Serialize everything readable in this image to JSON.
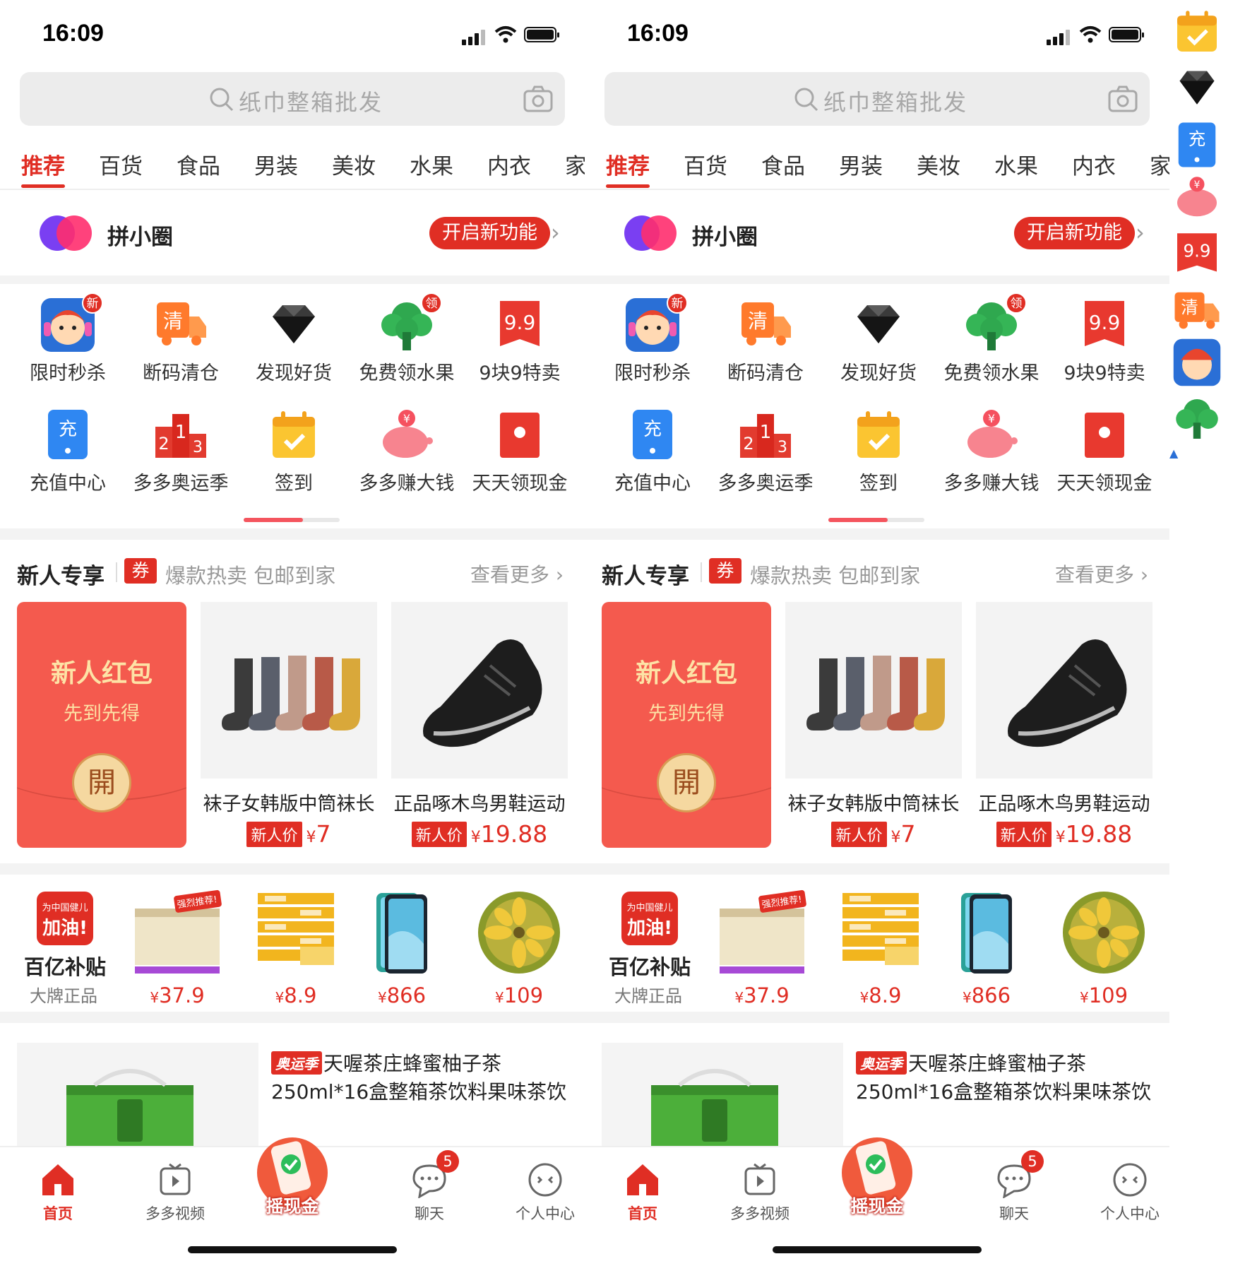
{
  "status": {
    "time": "16:09"
  },
  "search": {
    "placeholder": "纸巾整箱批发"
  },
  "tabs": [
    "推荐",
    "百货",
    "食品",
    "男装",
    "美妆",
    "水果",
    "内衣",
    "家装"
  ],
  "pxq": {
    "title": "拼小圈",
    "button": "开启新功能"
  },
  "grid": [
    {
      "label": "限时秒杀",
      "icon": "flash-sale-icon",
      "badge": "新"
    },
    {
      "label": "断码清仓",
      "icon": "clearance-truck-icon",
      "glyph": "清"
    },
    {
      "label": "发现好货",
      "icon": "diamond-icon"
    },
    {
      "label": "免费领水果",
      "icon": "tree-icon",
      "badge": "领"
    },
    {
      "label": "9块9特卖",
      "icon": "nine-nine-icon",
      "glyph": "9.9"
    },
    {
      "label": "充值中心",
      "icon": "phone-recharge-icon",
      "glyph": "充"
    },
    {
      "label": "多多奥运季",
      "icon": "podium-icon",
      "glyph": [
        "2",
        "1",
        "3"
      ]
    },
    {
      "label": "签到",
      "icon": "calendar-check-icon"
    },
    {
      "label": "多多赚大钱",
      "icon": "piggy-bank-icon",
      "glyph": "¥"
    },
    {
      "label": "天天领现金",
      "icon": "red-envelope-icon"
    }
  ],
  "newcomer": {
    "title": "新人专享",
    "coupon": "券",
    "subtitle": "爆款热卖 包邮到家",
    "more": "查看更多",
    "hongbao": {
      "title": "新人红包",
      "subtitle": "先到先得",
      "open": "開"
    },
    "products": [
      {
        "name": "袜子女韩版中筒袜长",
        "tag": "新人价",
        "currency": "¥",
        "price": "7"
      },
      {
        "name": "正品啄木鸟男鞋运动",
        "tag": "新人价",
        "currency": "¥",
        "price": "19.88"
      }
    ]
  },
  "subsidy": {
    "logo_small": "为中国健儿",
    "logo_big": "加油!",
    "title": "百亿补贴",
    "subtitle": "大牌正品",
    "recommend_tag": "强烈推荐!",
    "items": [
      {
        "currency": "¥",
        "price": "37.9",
        "icon": "tissue-box-icon"
      },
      {
        "currency": "¥",
        "price": "8.9",
        "icon": "tissue-stack-icon"
      },
      {
        "currency": "¥",
        "price": "866",
        "icon": "smartphone-icon"
      },
      {
        "currency": "¥",
        "price": "109",
        "icon": "durian-icon"
      }
    ]
  },
  "feed": {
    "tag": "奥运季",
    "title_line1": "天喔茶庄蜂蜜柚子茶",
    "title_line2": "250ml*16盒整箱茶饮料果味茶饮"
  },
  "tabbar": [
    {
      "label": "首页",
      "icon": "home-icon",
      "active": true
    },
    {
      "label": "多多视频",
      "icon": "video-icon"
    },
    {
      "label": "摇现金",
      "icon": "shake-cash-icon"
    },
    {
      "label": "聊天",
      "icon": "chat-icon",
      "badge": "5"
    },
    {
      "label": "个人中心",
      "icon": "profile-icon"
    }
  ],
  "colors": {
    "accent": "#e02e24",
    "hongbao": "#f45a4e",
    "gold": "#fde3a6"
  }
}
